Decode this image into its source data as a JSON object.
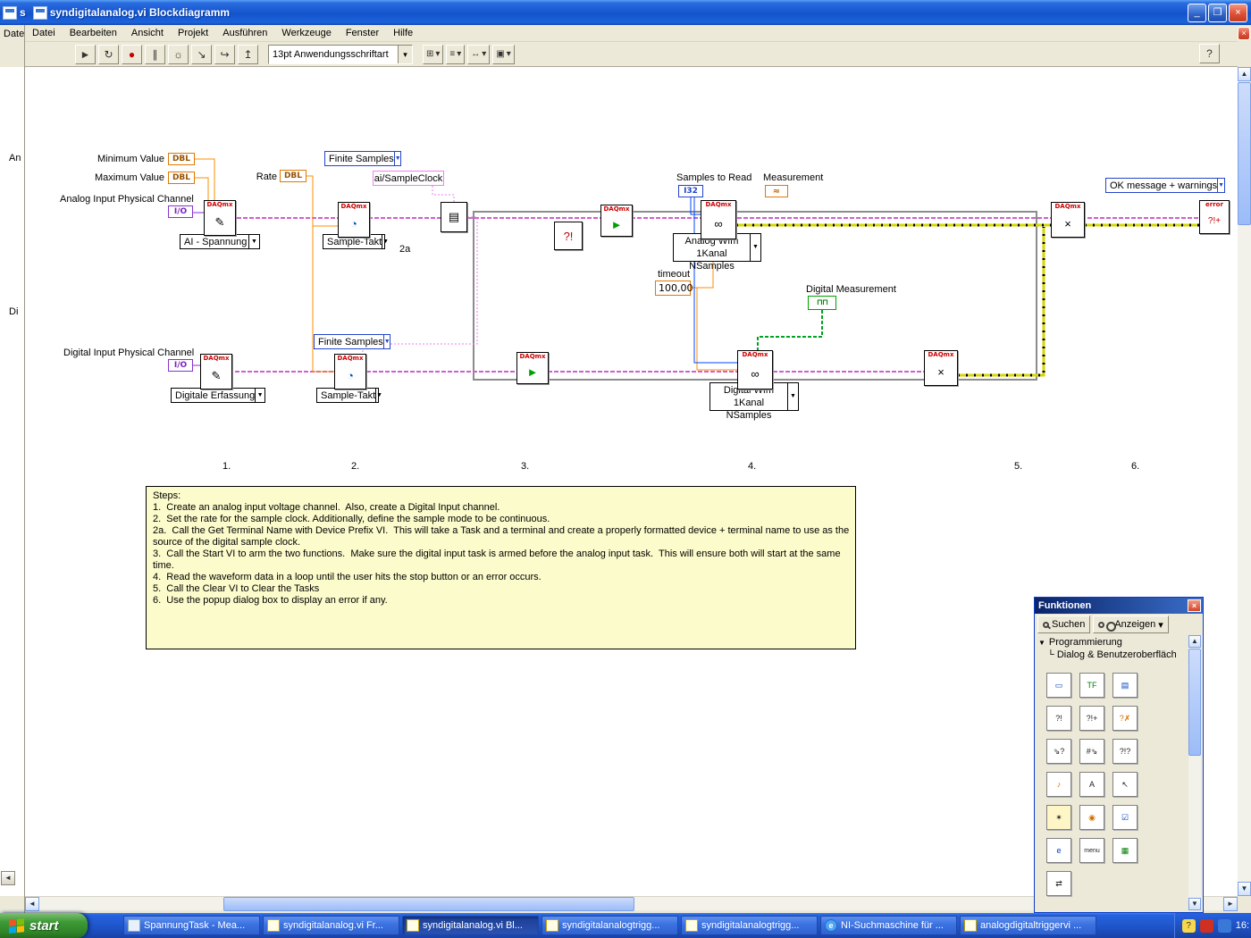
{
  "titlebar": {
    "bg_label": "s",
    "title": "syndigitalanalog.vi Blockdiagramm",
    "buttons": {
      "min": "_",
      "max": "❐",
      "close": "×"
    }
  },
  "menubar": {
    "bg_item": "Date",
    "items": [
      "Datei",
      "Bearbeiten",
      "Ansicht",
      "Projekt",
      "Ausführen",
      "Werkzeuge",
      "Fenster",
      "Hilfe"
    ]
  },
  "toolbar": {
    "font_selector": "13pt Anwendungsschriftart",
    "help": "?",
    "buttons": {
      "run": "►",
      "run_continuous": "↻",
      "abort": "●",
      "pause": "∥",
      "highlight": "☼",
      "step_into": "↘",
      "step_over": "↪",
      "step_out": "↥",
      "align": "⊞",
      "distribute": "≡",
      "resize": "↔",
      "reorder": "▣",
      "caret": "▾"
    }
  },
  "bg_strip": {
    "label_analog": "An",
    "label_digital": "Di",
    "scroll_left": "◄"
  },
  "diagram": {
    "daqmx": "DAQmx",
    "node_glyphs": {
      "create": "✎",
      "timing": "◔",
      "start": "►",
      "read": "∞",
      "clear": "×",
      "terminal": "▤",
      "check": "?!",
      "error_head": "error",
      "error_glyph": "?!+",
      "wave": "≈",
      "digital_wave": "⊓⊓"
    },
    "labels": {
      "minimum_value": "Minimum Value",
      "maximum_value": "Maximum Value",
      "rate": "Rate",
      "analog_channel": "Analog Input Physical Channel",
      "digital_channel": "Digital Input Physical Channel",
      "samples_to_read": "Samples to Read",
      "measurement": "Measurement",
      "digital_measurement": "Digital Measurement",
      "timeout": "timeout",
      "sample_clock": "ai/SampleClock",
      "step_2a": "2a"
    },
    "constants": {
      "dbl": "DBL",
      "io": "I/O",
      "i32": "I32",
      "timeout_value": "100,00"
    },
    "rings": {
      "finite_samples": "Finite Samples",
      "ai_spannung": "AI - Spannung",
      "sample_takt": "Sample-Takt",
      "digitale_erfassung": "Digitale Erfassung",
      "analog_wfm_1": "Analog Wfm",
      "analog_wfm_2": "1Kanal NSamples",
      "digital_wfm_1": "Digital Wfm",
      "digital_wfm_2": "1Kanal NSamples",
      "ok_message": "OK message + warnings"
    },
    "markers": [
      "1.",
      "2.",
      "3.",
      "4.",
      "5.",
      "6."
    ],
    "note_lines": [
      "Steps:",
      "1.  Create an analog input voltage channel.  Also, create a Digital Input channel.",
      "2.  Set the rate for the sample clock. Additionally, define the sample mode to be continuous.",
      "2a.  Call the Get Terminal Name with Device Prefix VI.  This will take a Task and a terminal and create a properly formatted device + terminal name to use as the",
      "source of the digital sample clock.",
      "3.  Call the Start VI to arm the two functions.  Make sure the digital input task is armed before the analog input task.  This will ensure both will start at the same",
      "time.",
      "4.  Read the waveform data in a loop until the user hits the stop button or an error occurs.",
      "5.  Call the Clear VI to Clear the Tasks",
      "6.  Use the popup dialog box to display an error if any."
    ]
  },
  "palette": {
    "title": "Funktionen",
    "search": "Suchen",
    "view": "Anzeigen",
    "view_caret": "▾",
    "tree_caret": "▼",
    "tree_branch": "└",
    "tree_root": "Programmierung",
    "tree_child": "Dialog & Benutzeroberfläch",
    "icons": [
      {
        "name": "one-button-dialog",
        "glyph": "▭"
      },
      {
        "name": "two-button-dialog",
        "glyph": "TF"
      },
      {
        "name": "three-button-dialog",
        "glyph": "▤"
      },
      {
        "name": "simple-error-handler",
        "glyph": "?!"
      },
      {
        "name": "general-error-handler",
        "glyph": "?!+"
      },
      {
        "name": "clear-errors",
        "glyph": "?✗"
      },
      {
        "name": "merge-errors",
        "glyph": "⇘?"
      },
      {
        "name": "find-first-error",
        "glyph": "#⇘"
      },
      {
        "name": "error-query",
        "glyph": "?!?"
      },
      {
        "name": "beep",
        "glyph": "♪"
      },
      {
        "name": "text-display",
        "glyph": "A"
      },
      {
        "name": "cursor-tools",
        "glyph": "↖"
      },
      {
        "name": "sparkle-tool",
        "glyph": "✶"
      },
      {
        "name": "color-picker",
        "glyph": "◉"
      },
      {
        "name": "checkbox-control",
        "glyph": "☑"
      },
      {
        "name": "express-vi",
        "glyph": "e"
      },
      {
        "name": "menu-functions",
        "glyph": "menu"
      },
      {
        "name": "graph-control",
        "glyph": "▦"
      },
      {
        "name": "sync-arrows",
        "glyph": "⇄"
      }
    ]
  },
  "taskbar": {
    "start": "start",
    "tasks": [
      "SpannungTask - Mea...",
      "syndigitalanalog.vi Fr...",
      "syndigitalanalog.vi Bl...",
      "syndigitalanalogtrigg...",
      "syndigitalanalogtrigg...",
      "NI-Suchmaschine für ...",
      "analogdigitaltriggervi ..."
    ],
    "ie_glyph": "e",
    "tray_help_glyph": "?",
    "time": "16:"
  }
}
